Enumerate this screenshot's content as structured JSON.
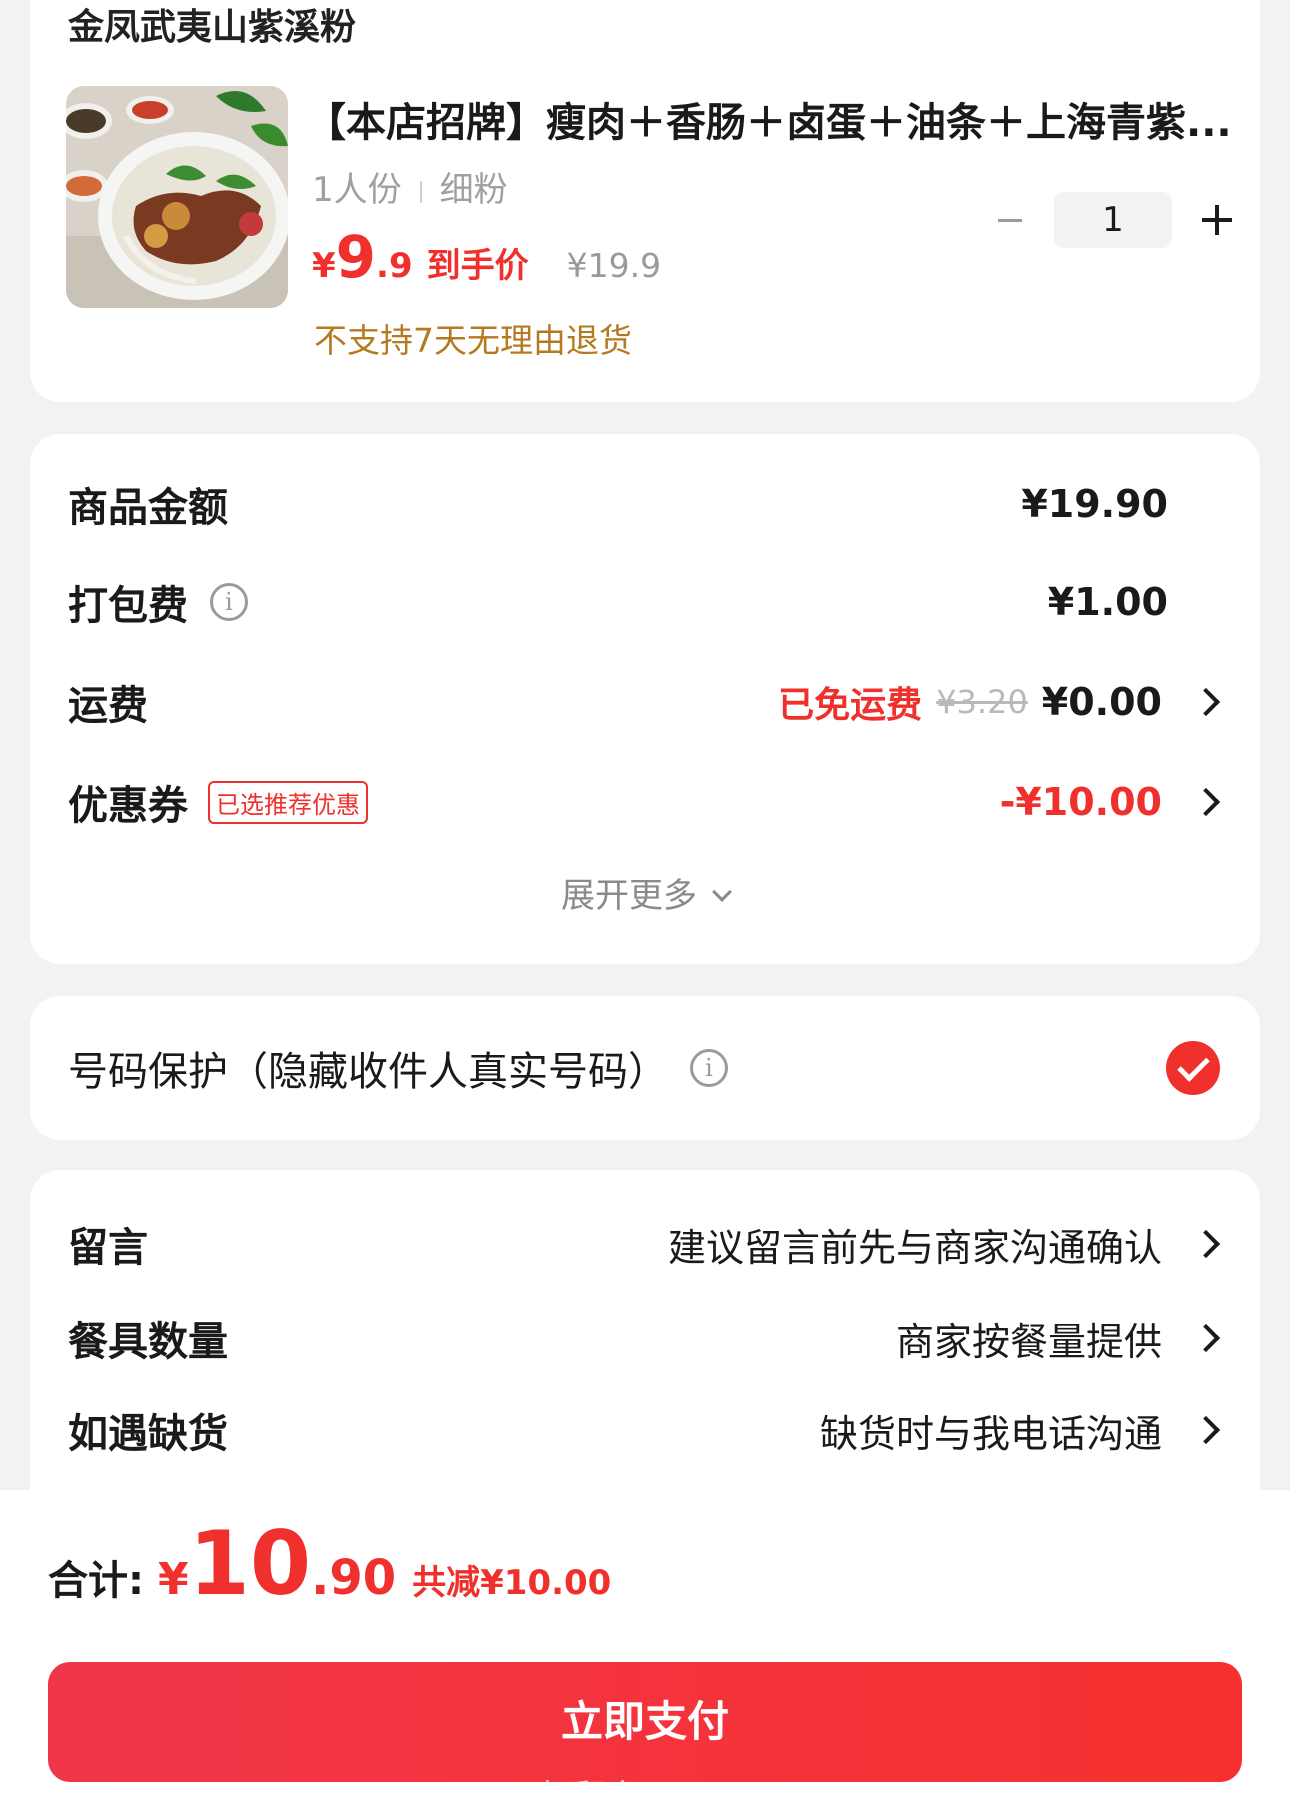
{
  "product": {
    "shop_name": "金凤武夷山紫溪粉",
    "title": "【本店招牌】瘦肉＋香肠＋卤蛋＋油条＋上海青紫...",
    "spec_servings": "1人份",
    "spec_noodle": "细粉",
    "price_currency": "¥",
    "price_integer": "9",
    "price_decimal": ".9",
    "price_tag": "到手价",
    "price_original": "¥19.9",
    "quantity": "1",
    "return_policy": "不支持7天无理由退货"
  },
  "summary": {
    "goods_label": "商品金额",
    "goods_value": "¥19.90",
    "packing_label": "打包费",
    "packing_value": "¥1.00",
    "shipping_label": "运费",
    "shipping_free": "已免运费",
    "shipping_original": "¥3.20",
    "shipping_value": "¥0.00",
    "coupon_label": "优惠券",
    "coupon_badge": "已选推荐优惠",
    "coupon_value": "-¥10.00",
    "expand_label": "展开更多"
  },
  "privacy": {
    "label": "号码保护（隐藏收件人真实号码）",
    "checked": true
  },
  "notes": {
    "message_label": "留言",
    "message_placeholder": "建议留言前先与商家沟通确认",
    "utensils_label": "餐具数量",
    "utensils_value": "商家按餐量提供",
    "stockout_label": "如遇缺货",
    "stockout_value": "缺货时与我电话沟通"
  },
  "checkout": {
    "total_label": "合计:",
    "total_currency": "¥",
    "total_integer": "10",
    "total_decimal": ".90",
    "total_saving": "共减¥10.00",
    "pay_label": "立即支付"
  },
  "watermark": "了不想翻身",
  "colors": {
    "accent": "#f0302c",
    "return_policy": "#b47a20",
    "background": "#f2f2f2"
  }
}
